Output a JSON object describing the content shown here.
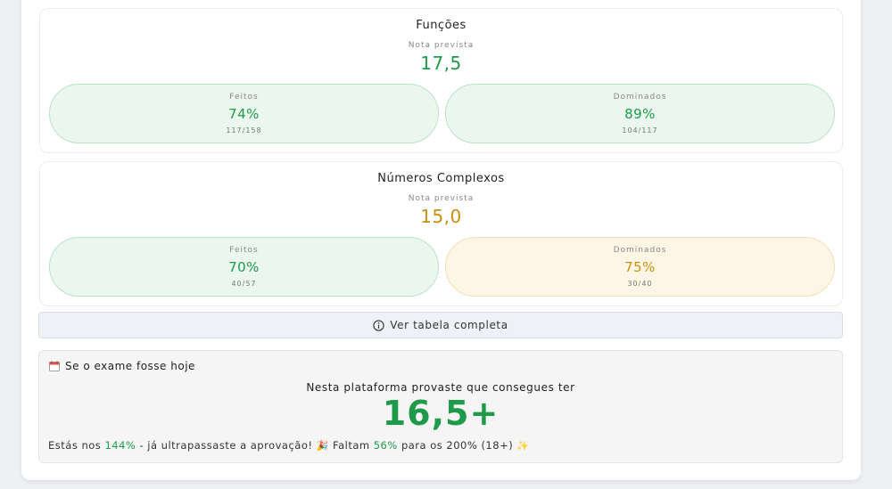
{
  "subjects": [
    {
      "title": "Funções",
      "grade_label": "Nota prevista",
      "grade_value": "17,5",
      "done": {
        "label": "Feitos",
        "percent": "74%",
        "count": "117/158"
      },
      "mastered": {
        "label": "Dominados",
        "percent": "89%",
        "count": "104/117"
      }
    },
    {
      "title": "Números Complexos",
      "grade_label": "Nota prevista",
      "grade_value": "15,0",
      "done": {
        "label": "Feitos",
        "percent": "70%",
        "count": "40/57"
      },
      "mastered": {
        "label": "Dominados",
        "percent": "75%",
        "count": "30/40"
      }
    }
  ],
  "table_button": {
    "label": "Ver tabela completa",
    "icon": "info-icon"
  },
  "exam": {
    "icon": "calendar-icon",
    "header": "Se o exame fosse hoje",
    "subtitle": "Nesta plataforma provaste que consegues ter",
    "grade": "16,5+",
    "footer": {
      "part1": "Estás nos ",
      "pct1": "144%",
      "part2": " - já ultrapassaste a aprovação! ",
      "emoji1": "🎉",
      "part3": " Faltam ",
      "pct2": "56%",
      "part4": " para os 200% (18+) ",
      "emoji2": "✨"
    }
  },
  "colors": {
    "green": "#1e9a4a",
    "amber": "#c9900f",
    "pill_green_bg": "#ebf7ee",
    "pill_amber_bg": "#fdf6e6"
  }
}
